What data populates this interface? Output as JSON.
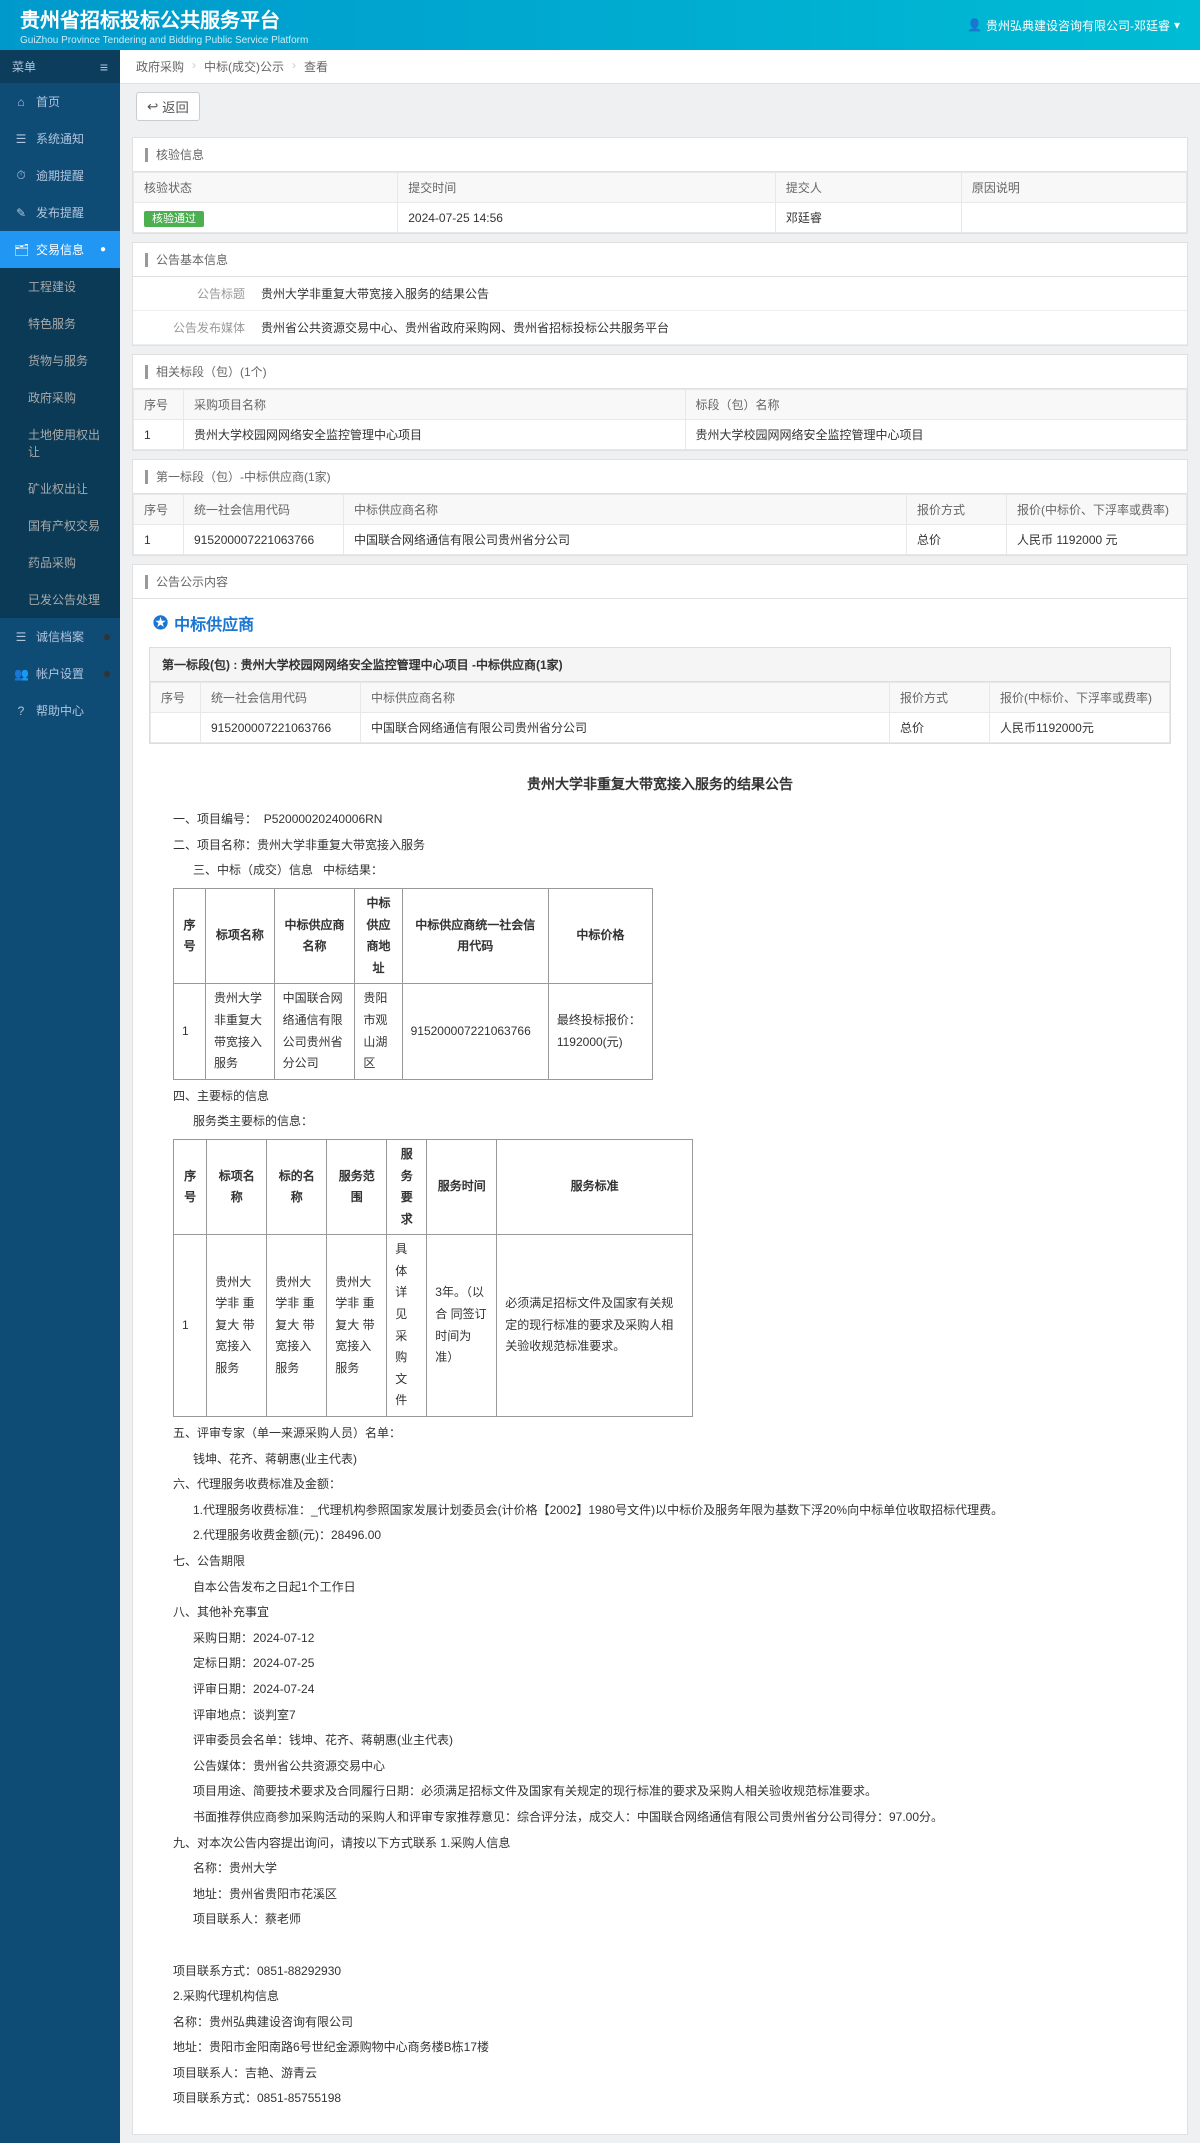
{
  "header": {
    "title": "贵州省招标投标公共服务平台",
    "subtitle": "GuiZhou Province Tendering and Bidding Public Service Platform",
    "user": "贵州弘典建设咨询有限公司-邓廷睿"
  },
  "sidebar": {
    "menu_label": "菜单",
    "items": [
      {
        "icon": "⌂",
        "label": "首页"
      },
      {
        "icon": "☰",
        "label": "系统通知"
      },
      {
        "icon": "⏱",
        "label": "逾期提醒"
      },
      {
        "icon": "✎",
        "label": "发布提醒"
      },
      {
        "icon": "🗂",
        "label": "交易信息",
        "active": true,
        "expand": true
      },
      {
        "label": "工程建设",
        "sub": true
      },
      {
        "label": "特色服务",
        "sub": true
      },
      {
        "label": "货物与服务",
        "sub": true
      },
      {
        "label": "政府采购",
        "sub": true
      },
      {
        "label": "土地使用权出让",
        "sub": true
      },
      {
        "label": "矿业权出让",
        "sub": true
      },
      {
        "label": "国有产权交易",
        "sub": true
      },
      {
        "label": "药品采购",
        "sub": true
      },
      {
        "label": "已发公告处理",
        "sub": true
      },
      {
        "icon": "☰",
        "label": "诚信档案",
        "dot": true
      },
      {
        "icon": "👥",
        "label": "帐户设置",
        "dot": true
      },
      {
        "icon": "?",
        "label": "帮助中心"
      }
    ]
  },
  "breadcrumb": [
    "政府采购",
    "中标(成交)公示",
    "查看"
  ],
  "back_label": "返回",
  "verify": {
    "title": "核验信息",
    "headers": [
      "核验状态",
      "提交时间",
      "提交人",
      "原因说明"
    ],
    "status_badge": "核验通过",
    "time": "2024-07-25 14:56",
    "submitter": "邓廷睿",
    "reason": ""
  },
  "basic": {
    "title": "公告基本信息",
    "rows": [
      {
        "label": "公告标题",
        "value": "贵州大学非重复大带宽接入服务的结果公告"
      },
      {
        "label": "公告发布媒体",
        "value": "贵州省公共资源交易中心、贵州省政府采购网、贵州省招标投标公共服务平台"
      }
    ]
  },
  "packages": {
    "title": "相关标段（包）(1个)",
    "headers": [
      "序号",
      "采购项目名称",
      "标段（包）名称"
    ],
    "rows": [
      {
        "no": "1",
        "proj": "贵州大学校园网网络安全监控管理中心项目",
        "pkg": "贵州大学校园网网络安全监控管理中心项目"
      }
    ]
  },
  "winners": {
    "title": "第一标段（包）-中标供应商(1家)",
    "headers": [
      "序号",
      "统一社会信用代码",
      "中标供应商名称",
      "报价方式",
      "报价(中标价、下浮率或费率)"
    ],
    "rows": [
      {
        "no": "1",
        "code": "915200007221063766",
        "name": "中国联合网络通信有限公司贵州省分公司",
        "method": "总价",
        "price": "人民币 1192000 元"
      }
    ]
  },
  "content_panel": {
    "title": "公告公示内容",
    "supplier_label": "中标供应商",
    "inner_title": "第一标段(包) : 贵州大学校园网网络安全监控管理中心项目 -中标供应商(1家)",
    "inner_headers": [
      "序号",
      "统一社会信用代码",
      "中标供应商名称",
      "报价方式",
      "报价(中标价、下浮率或费率)"
    ],
    "inner_row": {
      "no": "",
      "code": "915200007221063766",
      "name": "中国联合网络通信有限公司贵州省分公司",
      "method": "总价",
      "price": "人民币1192000元"
    }
  },
  "announce": {
    "title": "贵州大学非重复大带宽接入服务的结果公告",
    "proj_no_label": "一、项目编号：",
    "proj_no": "P52000020240006RN",
    "proj_name_label": "二、项目名称：",
    "proj_name": "贵州大学非重复大带宽接入服务",
    "result_label": "三、中标（成交）信息",
    "result_sub": "中标结果：",
    "table1": {
      "headers": [
        "序号",
        "标项名称",
        "中标供应商名称",
        "中标供应商地址",
        "中标供应商统一社会信用代码",
        "中标价格"
      ],
      "row": [
        "1",
        "贵州大学非重复大带宽接入服务",
        "中国联合网络通信有限公司贵州省分公司",
        "贵阳市观山湖区",
        "915200007221063766",
        "最终投标报价：1192000(元)"
      ]
    },
    "sec4_label": "四、主要标的信息",
    "sec4_sub": "服务类主要标的信息：",
    "table2": {
      "headers": [
        "序号",
        "标项名称",
        "标的名称",
        "服务范围",
        "服务要求",
        "服务时间",
        "服务标准"
      ],
      "row": [
        "1",
        "贵州大学非 重 复大 带 宽接入服务",
        "贵州大学非 重 复大 带 宽接入服务",
        "贵州大学非 重 复大 带 宽接入服务",
        "具体详 见采购文件",
        "3年。（以合 同签订时间为准）",
        "必须满足招标文件及国家有关规定的现行标准的要求及采购人相关验收规范标准要求。"
      ]
    },
    "sec5": "五、评审专家（单一来源采购人员）名单：",
    "sec5_names": "钱坤、花齐、蒋朝惠(业主代表)",
    "sec6": "六、代理服务收费标准及金额：",
    "sec6_1": "1.代理服务收费标准：_代理机构参照国家发展计划委员会(计价格【2002】1980号文件)以中标价及服务年限为基数下浮20%向中标单位收取招标代理费。",
    "sec6_2": "2.代理服务收费金额(元)：28496.00",
    "sec7": "七、公告期限",
    "sec7_body": "自本公告发布之日起1个工作日",
    "sec8": "八、其他补充事宜",
    "sec8_lines": [
      "采购日期：2024-07-12",
      "定标日期：2024-07-25",
      "评审日期：2024-07-24",
      "评审地点：谈判室7",
      "评审委员会名单：钱坤、花齐、蒋朝惠(业主代表)",
      "公告媒体：贵州省公共资源交易中心",
      "项目用途、简要技术要求及合同履行日期：必须满足招标文件及国家有关规定的现行标准的要求及采购人相关验收规范标准要求。",
      "书面推荐供应商参加采购活动的采购人和评审专家推荐意见：综合评分法，成交人：中国联合网络通信有限公司贵州省分公司得分：97.00分。"
    ],
    "sec9": "九、对本次公告内容提出询问，请按以下方式联系 1.采购人信息",
    "sec9_lines": [
      "名称：贵州大学",
      "地址：贵州省贵阳市花溪区",
      "项目联系人：蔡老师"
    ],
    "contact1": "项目联系方式：0851-88292930",
    "agency_title": "2.采购代理机构信息",
    "agency_lines": [
      "名称：贵州弘典建设咨询有限公司",
      "地址：贵阳市金阳南路6号世纪金源购物中心商务楼B栋17楼",
      "项目联系人：吉艳、游青云",
      "项目联系方式：0851-85755198"
    ]
  }
}
